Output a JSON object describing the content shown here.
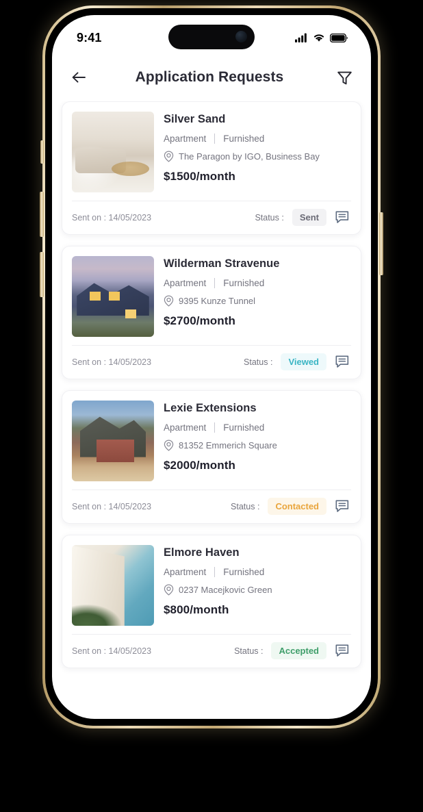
{
  "status_bar": {
    "time": "9:41",
    "icons": [
      "cellular-signal-icon",
      "wifi-icon",
      "battery-icon"
    ]
  },
  "header": {
    "back_icon": "arrow-left-icon",
    "title": "Application Requests",
    "filter_icon": "filter-funnel-icon"
  },
  "labels": {
    "sent_on_prefix": "Sent on : ",
    "status_prefix": "Status :",
    "location_icon": "map-pin-icon",
    "chat_icon": "chat-bubble-icon"
  },
  "status_colors": {
    "sent_text": "#6b6b76",
    "sent_bg": "#f2f2f4",
    "viewed_text": "#3ab5c4",
    "viewed_bg": "#eef9fb",
    "contacted_text": "#e9a53c",
    "contacted_bg": "#fdf6e9",
    "accepted_text": "#3f9e6a",
    "accepted_bg": "#eff8f2"
  },
  "cards": [
    {
      "name": "Silver Sand",
      "type": "Apartment",
      "furnishing": "Furnished",
      "address": "The Paragon by IGO, Business Bay",
      "price": "$1500/month",
      "sent_on": "Sent on : 14/05/2023",
      "status_label": "Status :",
      "status": "Sent",
      "thumb_class": "interior"
    },
    {
      "name": "Wilderman Stravenue",
      "type": "Apartment",
      "furnishing": "Furnished",
      "address": "9395 Kunze Tunnel",
      "price": "$2700/month",
      "sent_on": "Sent on : 14/05/2023",
      "status_label": "Status :",
      "status": "Viewed",
      "thumb_class": "house-dusk"
    },
    {
      "name": "Lexie Extensions",
      "type": "Apartment",
      "furnishing": "Furnished",
      "address": "81352 Emmerich Square",
      "price": "$2000/month",
      "sent_on": "Sent on : 14/05/2023",
      "status_label": "Status :",
      "status": "Contacted",
      "thumb_class": "house-brick"
    },
    {
      "name": "Elmore Haven",
      "type": "Apartment",
      "furnishing": "Furnished",
      "address": "0237 Macejkovic Green",
      "price": "$800/month",
      "sent_on": "Sent on : 14/05/2023",
      "status_label": "Status :",
      "status": "Accepted",
      "thumb_class": "building"
    }
  ]
}
